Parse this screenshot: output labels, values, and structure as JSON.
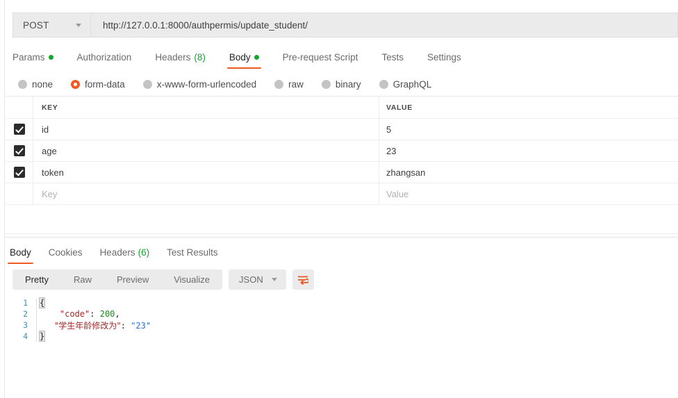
{
  "request": {
    "method": "POST",
    "url": "http://127.0.0.1:8000/authpermis/update_student/",
    "tabs": [
      {
        "label": "Params",
        "badge_dot": true,
        "active": false
      },
      {
        "label": "Authorization",
        "active": false
      },
      {
        "label": "Headers",
        "count": "(8)",
        "active": false
      },
      {
        "label": "Body",
        "badge_dot": true,
        "active": true
      },
      {
        "label": "Pre-request Script",
        "active": false
      },
      {
        "label": "Tests",
        "active": false
      },
      {
        "label": "Settings",
        "active": false
      }
    ],
    "body_types": [
      {
        "label": "none",
        "selected": false
      },
      {
        "label": "form-data",
        "selected": true
      },
      {
        "label": "x-www-form-urlencoded",
        "selected": false
      },
      {
        "label": "raw",
        "selected": false
      },
      {
        "label": "binary",
        "selected": false
      },
      {
        "label": "GraphQL",
        "selected": false
      }
    ],
    "table": {
      "headers": {
        "key": "KEY",
        "value": "VALUE"
      },
      "rows": [
        {
          "checked": true,
          "key": "id",
          "value": "5"
        },
        {
          "checked": true,
          "key": "age",
          "value": "23"
        },
        {
          "checked": true,
          "key": "token",
          "value": "zhangsan"
        }
      ],
      "empty_row": {
        "key_placeholder": "Key",
        "value_placeholder": "Value"
      }
    }
  },
  "response": {
    "tabs": [
      {
        "label": "Body",
        "active": true
      },
      {
        "label": "Cookies",
        "active": false
      },
      {
        "label": "Headers",
        "count": "(6)",
        "active": false
      },
      {
        "label": "Test Results",
        "active": false
      }
    ],
    "view_modes": [
      {
        "label": "Pretty",
        "active": true
      },
      {
        "label": "Raw",
        "active": false
      },
      {
        "label": "Preview",
        "active": false
      },
      {
        "label": "Visualize",
        "active": false
      }
    ],
    "format": "JSON",
    "wrap_icon": "word-wrap-icon",
    "code": {
      "lines": [
        "1",
        "2",
        "3",
        "4"
      ],
      "l1_brace": "{",
      "l2_key": "\"code\"",
      "l2_colon": ": ",
      "l2_num": "200",
      "l2_comma": ",",
      "l3_key": "\"学生年龄修改为\"",
      "l3_colon": ": ",
      "l3_str": "\"23\"",
      "l4_brace": "}"
    }
  },
  "colors": {
    "accent_orange": "#ef5b25",
    "badge_green": "#18a52e",
    "toolbar_gray": "#ebebeb",
    "checkbox_dark": "#2c2c2c",
    "json_key": "#a52a2a",
    "json_number": "#1a8a1a",
    "json_string": "#2f6fd0",
    "line_number": "#3d8fb8"
  }
}
